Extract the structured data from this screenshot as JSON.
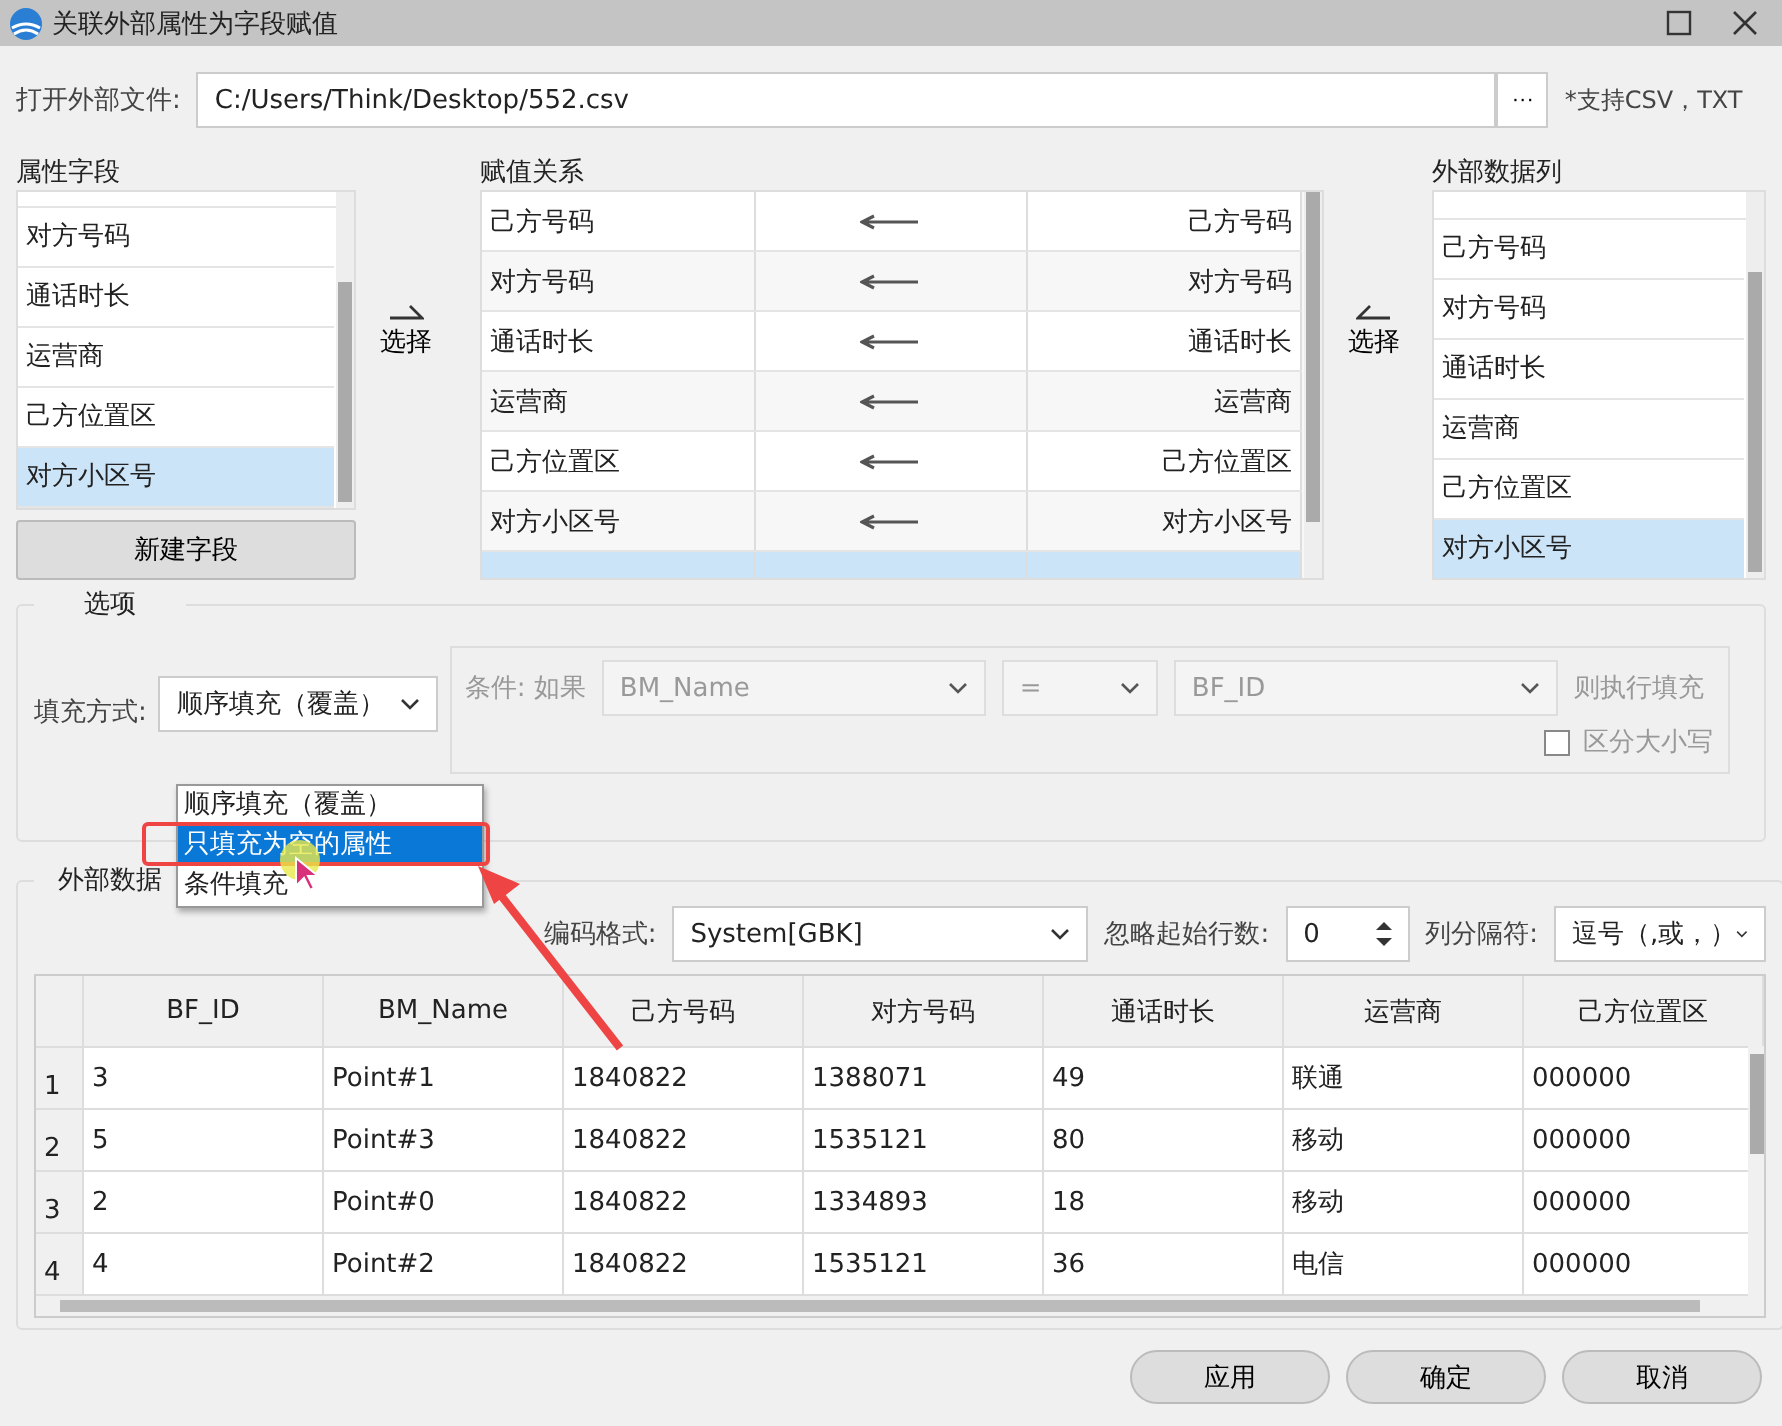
{
  "window": {
    "title": "关联外部属性为字段赋值"
  },
  "file": {
    "label": "打开外部文件:",
    "value": "C:/Users/Think/Desktop/552.csv",
    "browse": "···",
    "hint": "*支持CSV，TXT"
  },
  "attribute_fields": {
    "title": "属性字段",
    "items": [
      {
        "label": "对方号码",
        "selected": false
      },
      {
        "label": "通话时长",
        "selected": false
      },
      {
        "label": "运营商",
        "selected": false
      },
      {
        "label": "己方位置区",
        "selected": false
      },
      {
        "label": "对方小区号",
        "selected": true
      }
    ],
    "button": "新建字段"
  },
  "select_left": "选择",
  "mapping": {
    "title": "赋值关系",
    "rows": [
      {
        "target": "己方号码",
        "source": "己方号码",
        "selected": false
      },
      {
        "target": "对方号码",
        "source": "对方号码",
        "selected": false
      },
      {
        "target": "通话时长",
        "source": "通话时长",
        "selected": false
      },
      {
        "target": "运营商",
        "source": "运营商",
        "selected": false
      },
      {
        "target": "己方位置区",
        "source": "己方位置区",
        "selected": false
      },
      {
        "target": "对方小区号",
        "source": "对方小区号",
        "selected": false
      },
      {
        "selected": true
      }
    ]
  },
  "select_right": "选择",
  "external_columns": {
    "title": "外部数据列",
    "items": [
      {
        "label": "己方号码",
        "selected": false
      },
      {
        "label": "对方号码",
        "selected": false
      },
      {
        "label": "通话时长",
        "selected": false
      },
      {
        "label": "运营商",
        "selected": false
      },
      {
        "label": "己方位置区",
        "selected": false
      },
      {
        "label": "对方小区号",
        "selected": true
      }
    ]
  },
  "options": {
    "title": "选项",
    "fill_label": "填充方式:",
    "fill_value": "顺序填充（覆盖）",
    "dropdown_items": [
      {
        "label": "顺序填充（覆盖）",
        "selected": false
      },
      {
        "label": "只填充为空的属性",
        "selected": true
      },
      {
        "label": "条件填充",
        "selected": false
      }
    ],
    "condition": {
      "disabled": true,
      "label": "条件: 如果",
      "field": "BM_Name",
      "operator": "=",
      "value": "BF_ID",
      "then": "则执行填充",
      "case_label": "区分大小写",
      "case_checked": false
    }
  },
  "external_data": {
    "title": "外部数据",
    "encoding_label": "编码格式:",
    "encoding": "System[GBK]",
    "skip_label": "忽略起始行数:",
    "skip": "0",
    "separator_label": "列分隔符:",
    "separator": "逗号（,或，）",
    "table": {
      "columns": [
        "BF_ID",
        "BM_Name",
        "己方号码",
        "对方号码",
        "通话时长",
        "运营商",
        "己方位置区"
      ],
      "rows": [
        {
          "number": "1",
          "cells": [
            "3",
            "Point#1",
            "1840822",
            "1388071",
            "49",
            "联通",
            "000000"
          ]
        },
        {
          "number": "2",
          "cells": [
            "5",
            "Point#3",
            "1840822",
            "1535121",
            "80",
            "移动",
            "000000"
          ]
        },
        {
          "number": "3",
          "cells": [
            "2",
            "Point#0",
            "1840822",
            "1334893",
            "18",
            "移动",
            "000000"
          ]
        },
        {
          "number": "4",
          "cells": [
            "4",
            "Point#2",
            "1840822",
            "1535121",
            "36",
            "电信",
            "000000"
          ]
        }
      ]
    }
  },
  "buttons": [
    "应用",
    "确定",
    "取消"
  ]
}
